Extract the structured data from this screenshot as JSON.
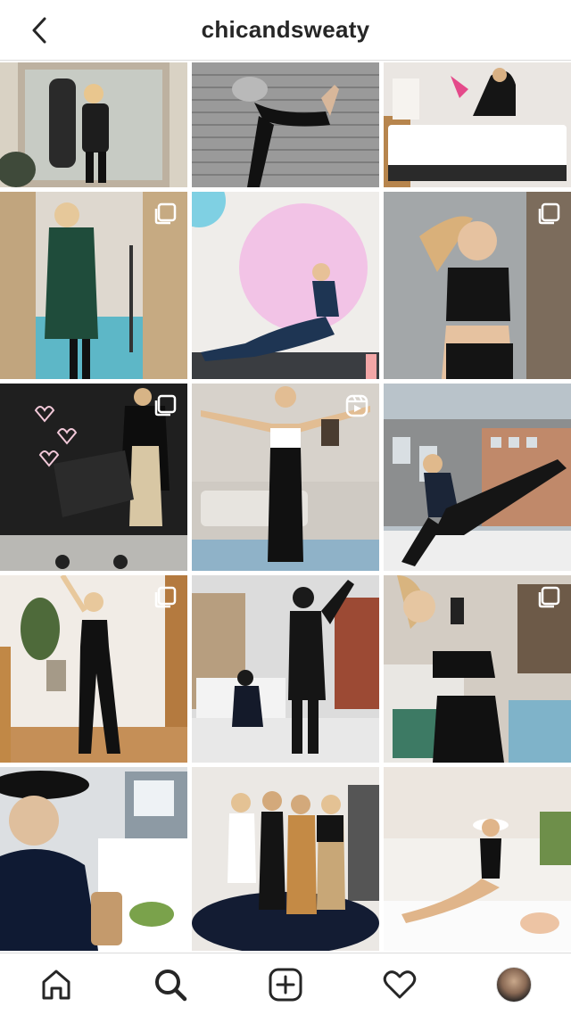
{
  "header": {
    "title": "chicandsweaty",
    "back_icon": "chevron-left-icon"
  },
  "grid": {
    "tiles": [
      {
        "name": "post-mirror-selfie-with-child",
        "badge": ""
      },
      {
        "name": "post-yoga-pose-garage",
        "badge": ""
      },
      {
        "name": "post-bed-with-child",
        "badge": ""
      },
      {
        "name": "post-green-coat-mirror",
        "badge": "carousel"
      },
      {
        "name": "post-pink-circle-yoga",
        "badge": ""
      },
      {
        "name": "post-sports-bra-smile",
        "badge": "carousel"
      },
      {
        "name": "post-stroller-street",
        "badge": "carousel"
      },
      {
        "name": "post-living-room-workout",
        "badge": "reel"
      },
      {
        "name": "post-rooftop-stretch",
        "badge": ""
      },
      {
        "name": "post-mirror-selfie-leggings",
        "badge": "carousel"
      },
      {
        "name": "post-snow-street-child",
        "badge": ""
      },
      {
        "name": "post-mesh-leggings-selfie",
        "badge": "carousel"
      },
      {
        "name": "post-hat-fur-coffee",
        "badge": ""
      },
      {
        "name": "post-group-four-women",
        "badge": ""
      },
      {
        "name": "post-cabana-baby",
        "badge": ""
      }
    ]
  },
  "nav": {
    "items": [
      {
        "name": "home",
        "icon": "home-icon"
      },
      {
        "name": "search",
        "icon": "search-icon"
      },
      {
        "name": "add",
        "icon": "add-post-icon"
      },
      {
        "name": "activity",
        "icon": "heart-icon"
      },
      {
        "name": "profile",
        "icon": "profile-avatar"
      }
    ]
  }
}
